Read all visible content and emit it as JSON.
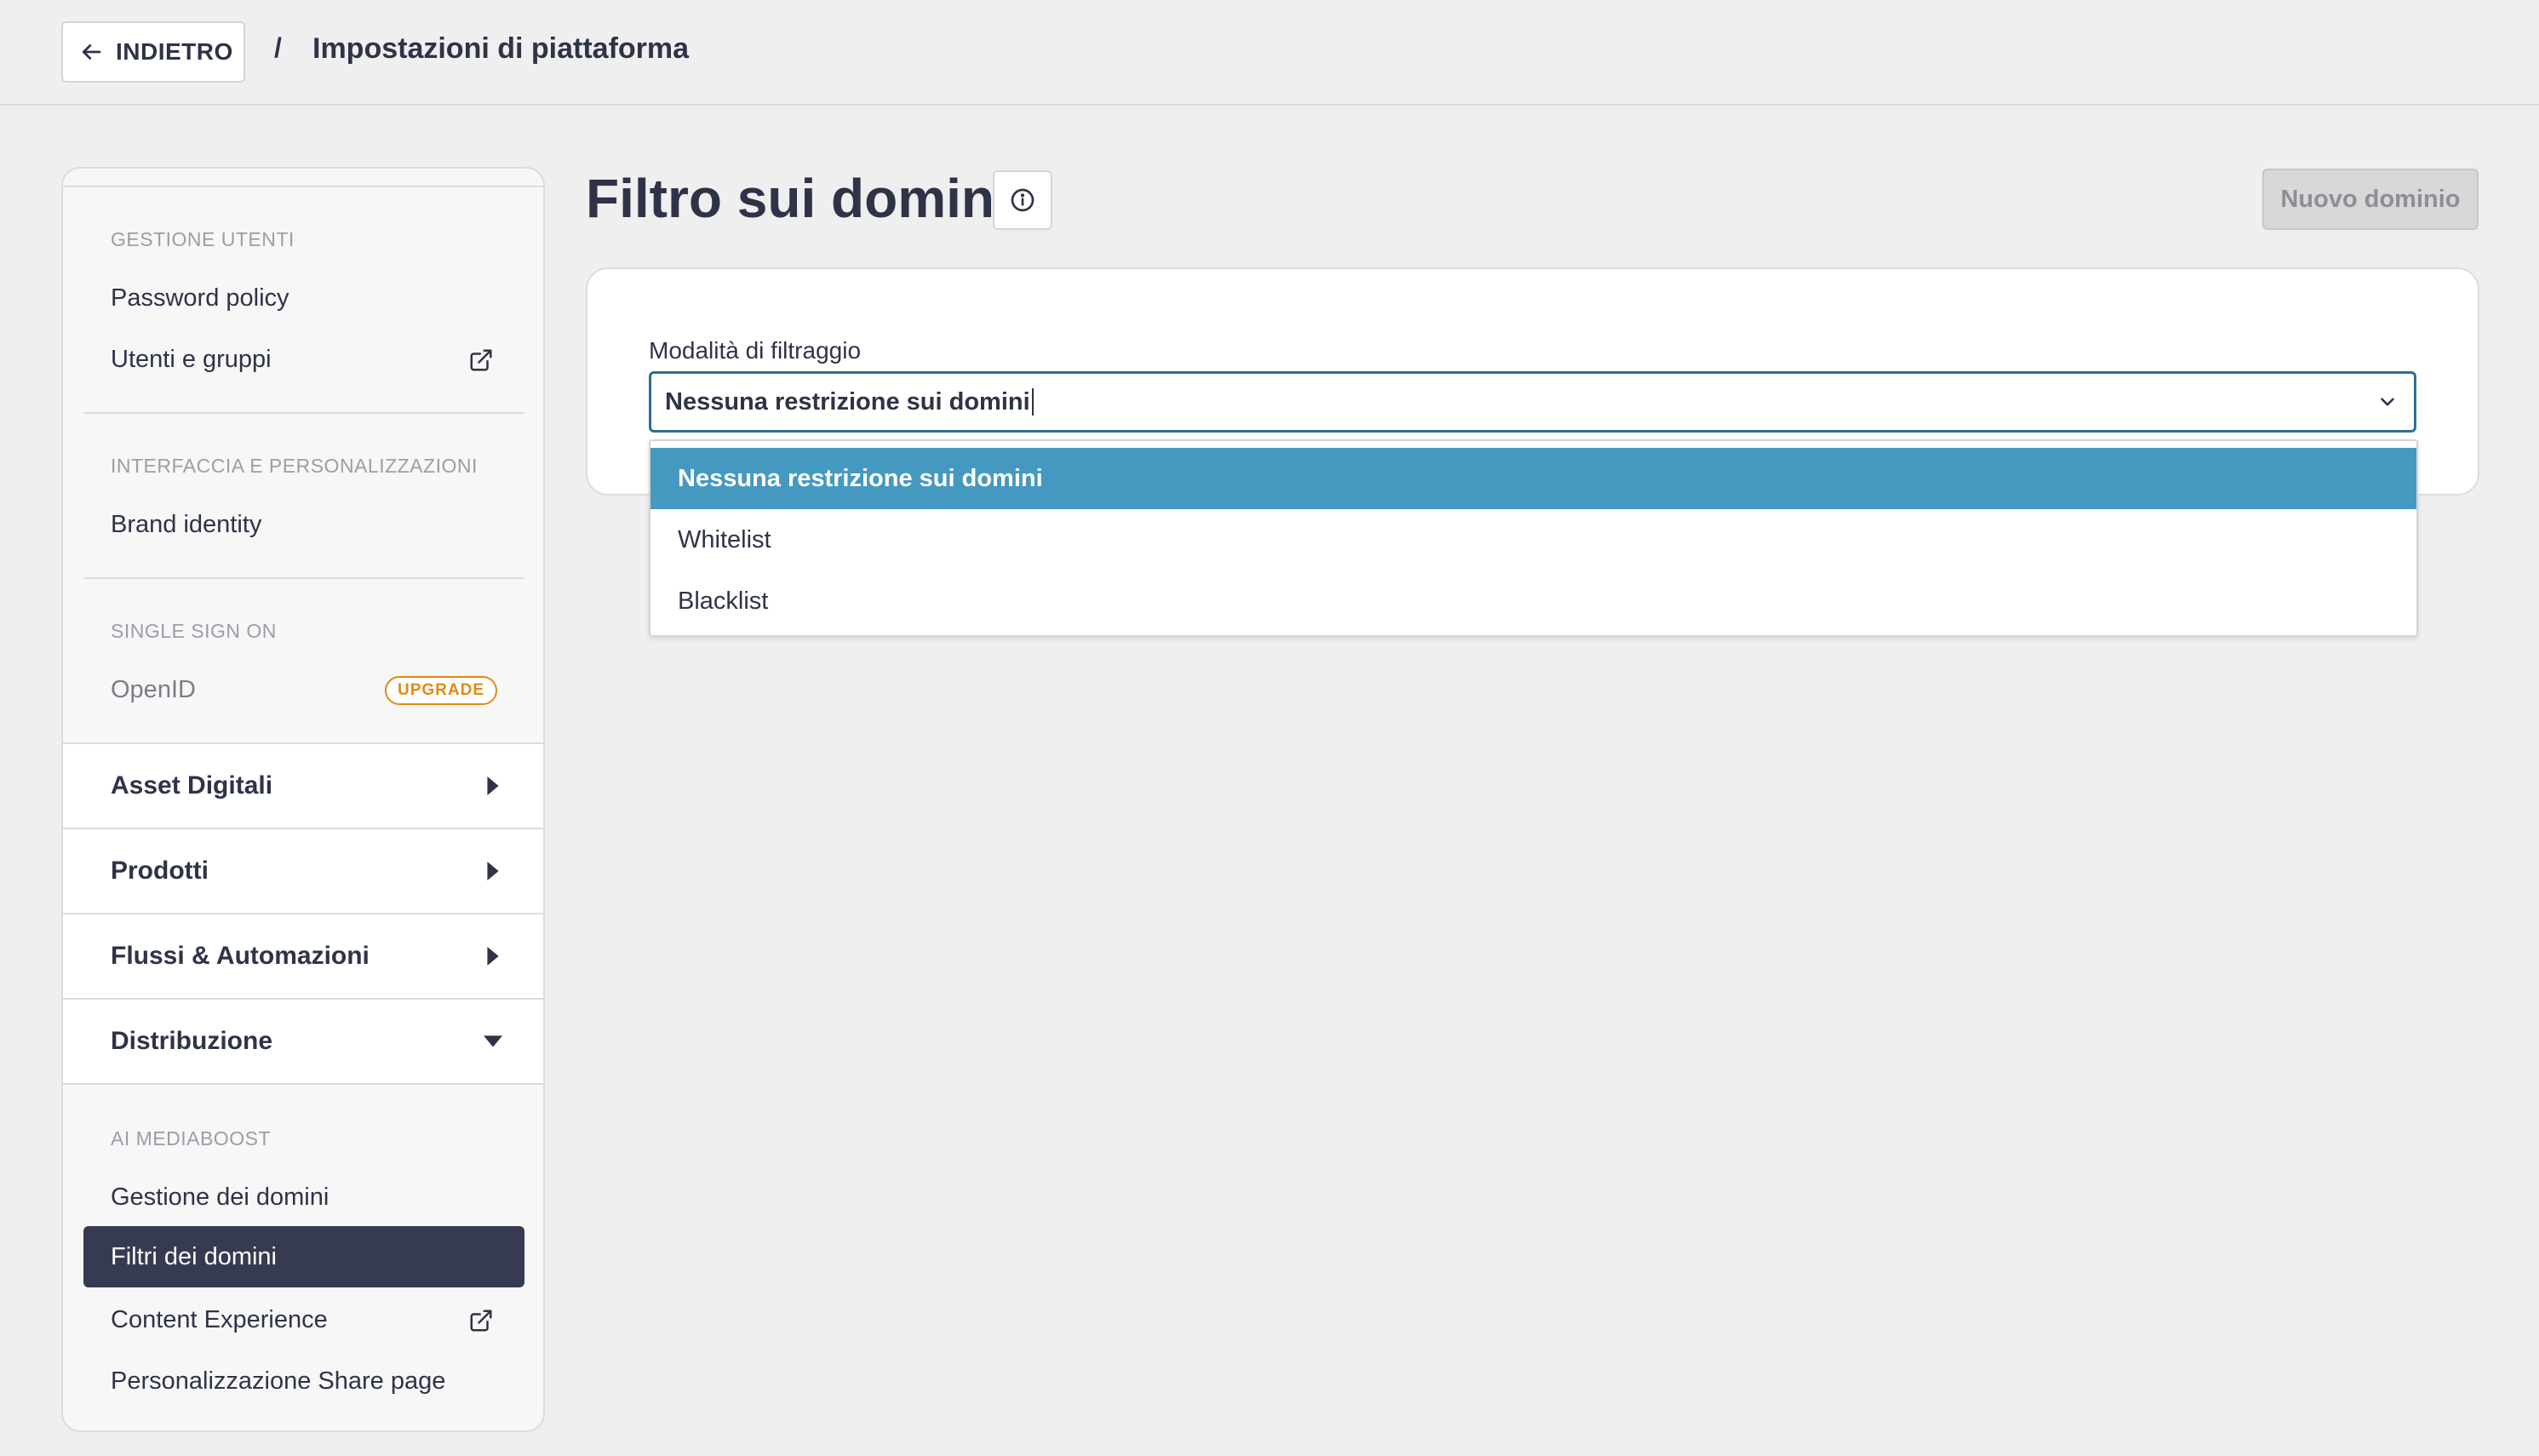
{
  "header": {
    "back_label": "INDIETRO",
    "separator": "/",
    "title": "Impostazioni di piattaforma"
  },
  "sidebar": {
    "sections": [
      {
        "heading": "GESTIONE UTENTI",
        "items": [
          {
            "label": "Password policy"
          },
          {
            "label": "Utenti e gruppi",
            "icon": "external-link-icon"
          }
        ]
      },
      {
        "heading": "INTERFACCIA E PERSONALIZZAZIONI",
        "items": [
          {
            "label": "Brand identity"
          }
        ]
      },
      {
        "heading": "SINGLE SIGN ON",
        "items": [
          {
            "label": "OpenID",
            "badge": "UPGRADE"
          }
        ]
      }
    ],
    "groups": [
      {
        "label": "Asset Digitali",
        "state": "collapsed"
      },
      {
        "label": "Prodotti",
        "state": "collapsed"
      },
      {
        "label": "Flussi & Automazioni",
        "state": "collapsed"
      },
      {
        "label": "Distribuzione",
        "state": "expanded"
      }
    ],
    "distribution": {
      "heading": "AI MEDIABOOST",
      "items": [
        {
          "label": "Gestione dei domini"
        },
        {
          "label": "Filtri dei domini",
          "active": true
        },
        {
          "label": "Content Experience",
          "icon": "external-link-icon"
        },
        {
          "label": "Personalizzazione Share page"
        }
      ]
    }
  },
  "main": {
    "title": "Filtro sui domini",
    "new_button": "Nuovo dominio",
    "filter": {
      "label": "Modalità di filtraggio",
      "value": "Nessuna restrizione sui domini",
      "options": [
        "Nessuna restrizione sui domini",
        "Whitelist",
        "Blacklist"
      ],
      "selected_index": 0
    }
  },
  "colors": {
    "accent_selected": "#4599c0",
    "active_nav": "#373b52",
    "upgrade_badge": "#e08a14",
    "focus_border": "#2e6f8e"
  }
}
